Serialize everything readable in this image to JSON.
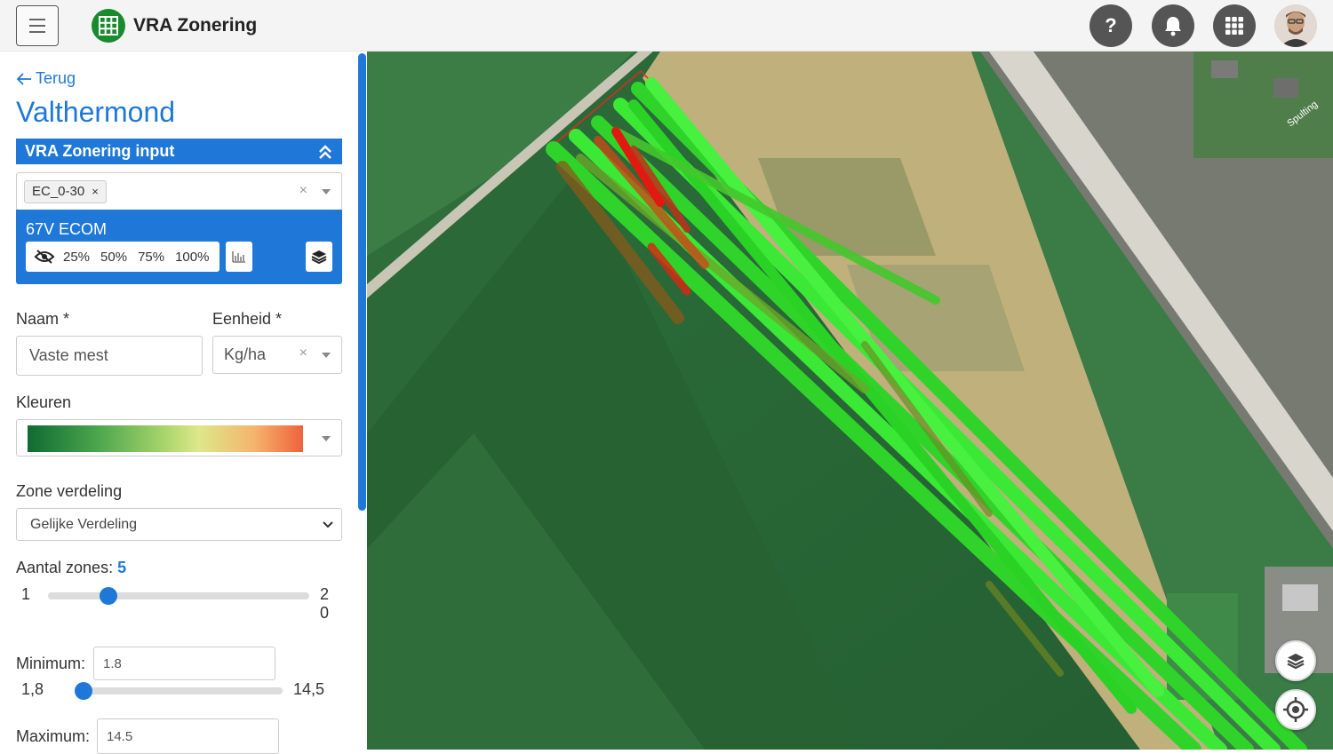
{
  "app": {
    "title": "VRA Zonering"
  },
  "header": {
    "help_label": "?",
    "icons": [
      "menu-icon",
      "grid-logo-icon",
      "help-icon",
      "bell-icon",
      "apps-grid-icon",
      "avatar"
    ]
  },
  "nav": {
    "back_label": "Terug"
  },
  "page": {
    "title": "Valthermond"
  },
  "section": {
    "title": "VRA Zonering input"
  },
  "input_layer": {
    "selected_tag": "EC_0-30",
    "tag_remove": "×",
    "clear": "×"
  },
  "layer_card": {
    "name": "67V ECOM",
    "opacity_options": [
      "25%",
      "50%",
      "75%",
      "100%"
    ]
  },
  "form": {
    "naam_label": "Naam *",
    "naam_value": "Vaste mest",
    "eenheid_label": "Eenheid *",
    "eenheid_value": "Kg/ha",
    "eenheid_clear": "×",
    "kleuren_label": "Kleuren",
    "gradient_colors": [
      "#0f6b32",
      "#4aa54d",
      "#a9d66b",
      "#dde88a",
      "#f5b56e",
      "#f0623a"
    ],
    "zone_label": "Zone verdeling",
    "zone_value": "Gelijke Verdeling",
    "aantal_label": "Aantal zones:",
    "aantal_value": "5",
    "zones_slider": {
      "min_label": "1",
      "max_label_line1": "2",
      "max_label_line2": "0",
      "min": 1,
      "max": 20,
      "value": 5
    },
    "minimum_label": "Minimum:",
    "minimum_value": "1.8",
    "min_slider": {
      "min_label": "1,8",
      "max_label": "14,5",
      "value_fraction": 0.0
    },
    "maximum_label": "Maximum:",
    "maximum_value": "14.5"
  },
  "colors": {
    "accent": "#1f78d8",
    "logo_green": "#1a8a2e"
  },
  "map": {
    "label_street": "Spulting"
  }
}
